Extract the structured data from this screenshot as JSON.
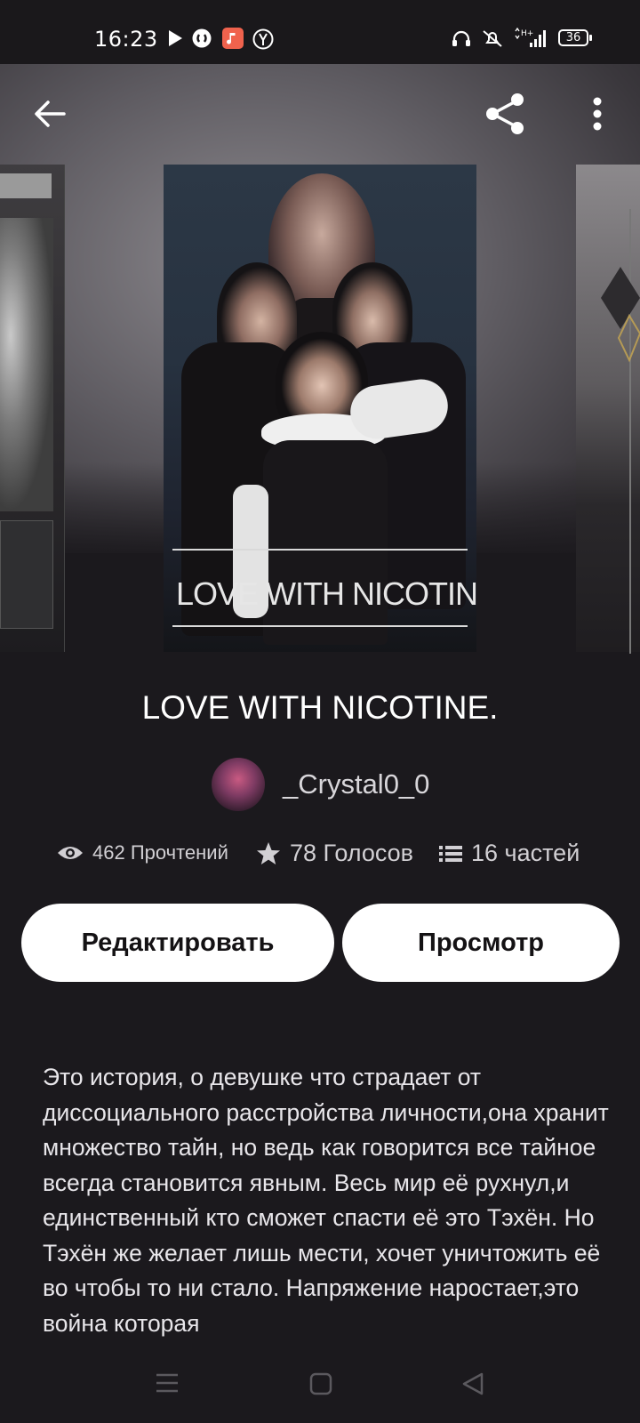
{
  "status_bar": {
    "time": "16:23",
    "battery": "36",
    "icons": [
      "play-icon",
      "shazam-icon",
      "music-app-icon",
      "yandex-icon",
      "headphones-icon",
      "mute-icon",
      "network-h-plus-icon",
      "signal-icon",
      "battery-icon"
    ]
  },
  "toolbar": {
    "back_icon": "arrow-left-icon",
    "share_icon": "share-icon",
    "menu_icon": "more-vertical-icon"
  },
  "cover": {
    "title_text": "LOVE WITH NICOTINE."
  },
  "story": {
    "title": "LOVE WITH NICOTINE.",
    "author": "_Crystal0_0",
    "reads": "462 Прочтений",
    "votes": "78 Голосов",
    "parts": "16 частей"
  },
  "actions": {
    "edit_label": "Редактировать",
    "view_label": "Просмотр"
  },
  "description": "Это история, о девушке что страдает от диссоциального расстройства личности,она хранит множество тайн, но ведь как говорится все тайное всегда становится явным. Весь мир её рухнул,и единственный кто сможет спасти её это Тэхён. Но Тэхён же желает лишь мести, хочет уничтожить её во чтобы то ни стало. Напряжение наростает,это война которая",
  "colors": {
    "background": "#1b191d",
    "button_bg": "#ffffff",
    "button_text": "#141214",
    "text_primary": "#ffffff",
    "text_secondary": "#d2d0d4"
  }
}
